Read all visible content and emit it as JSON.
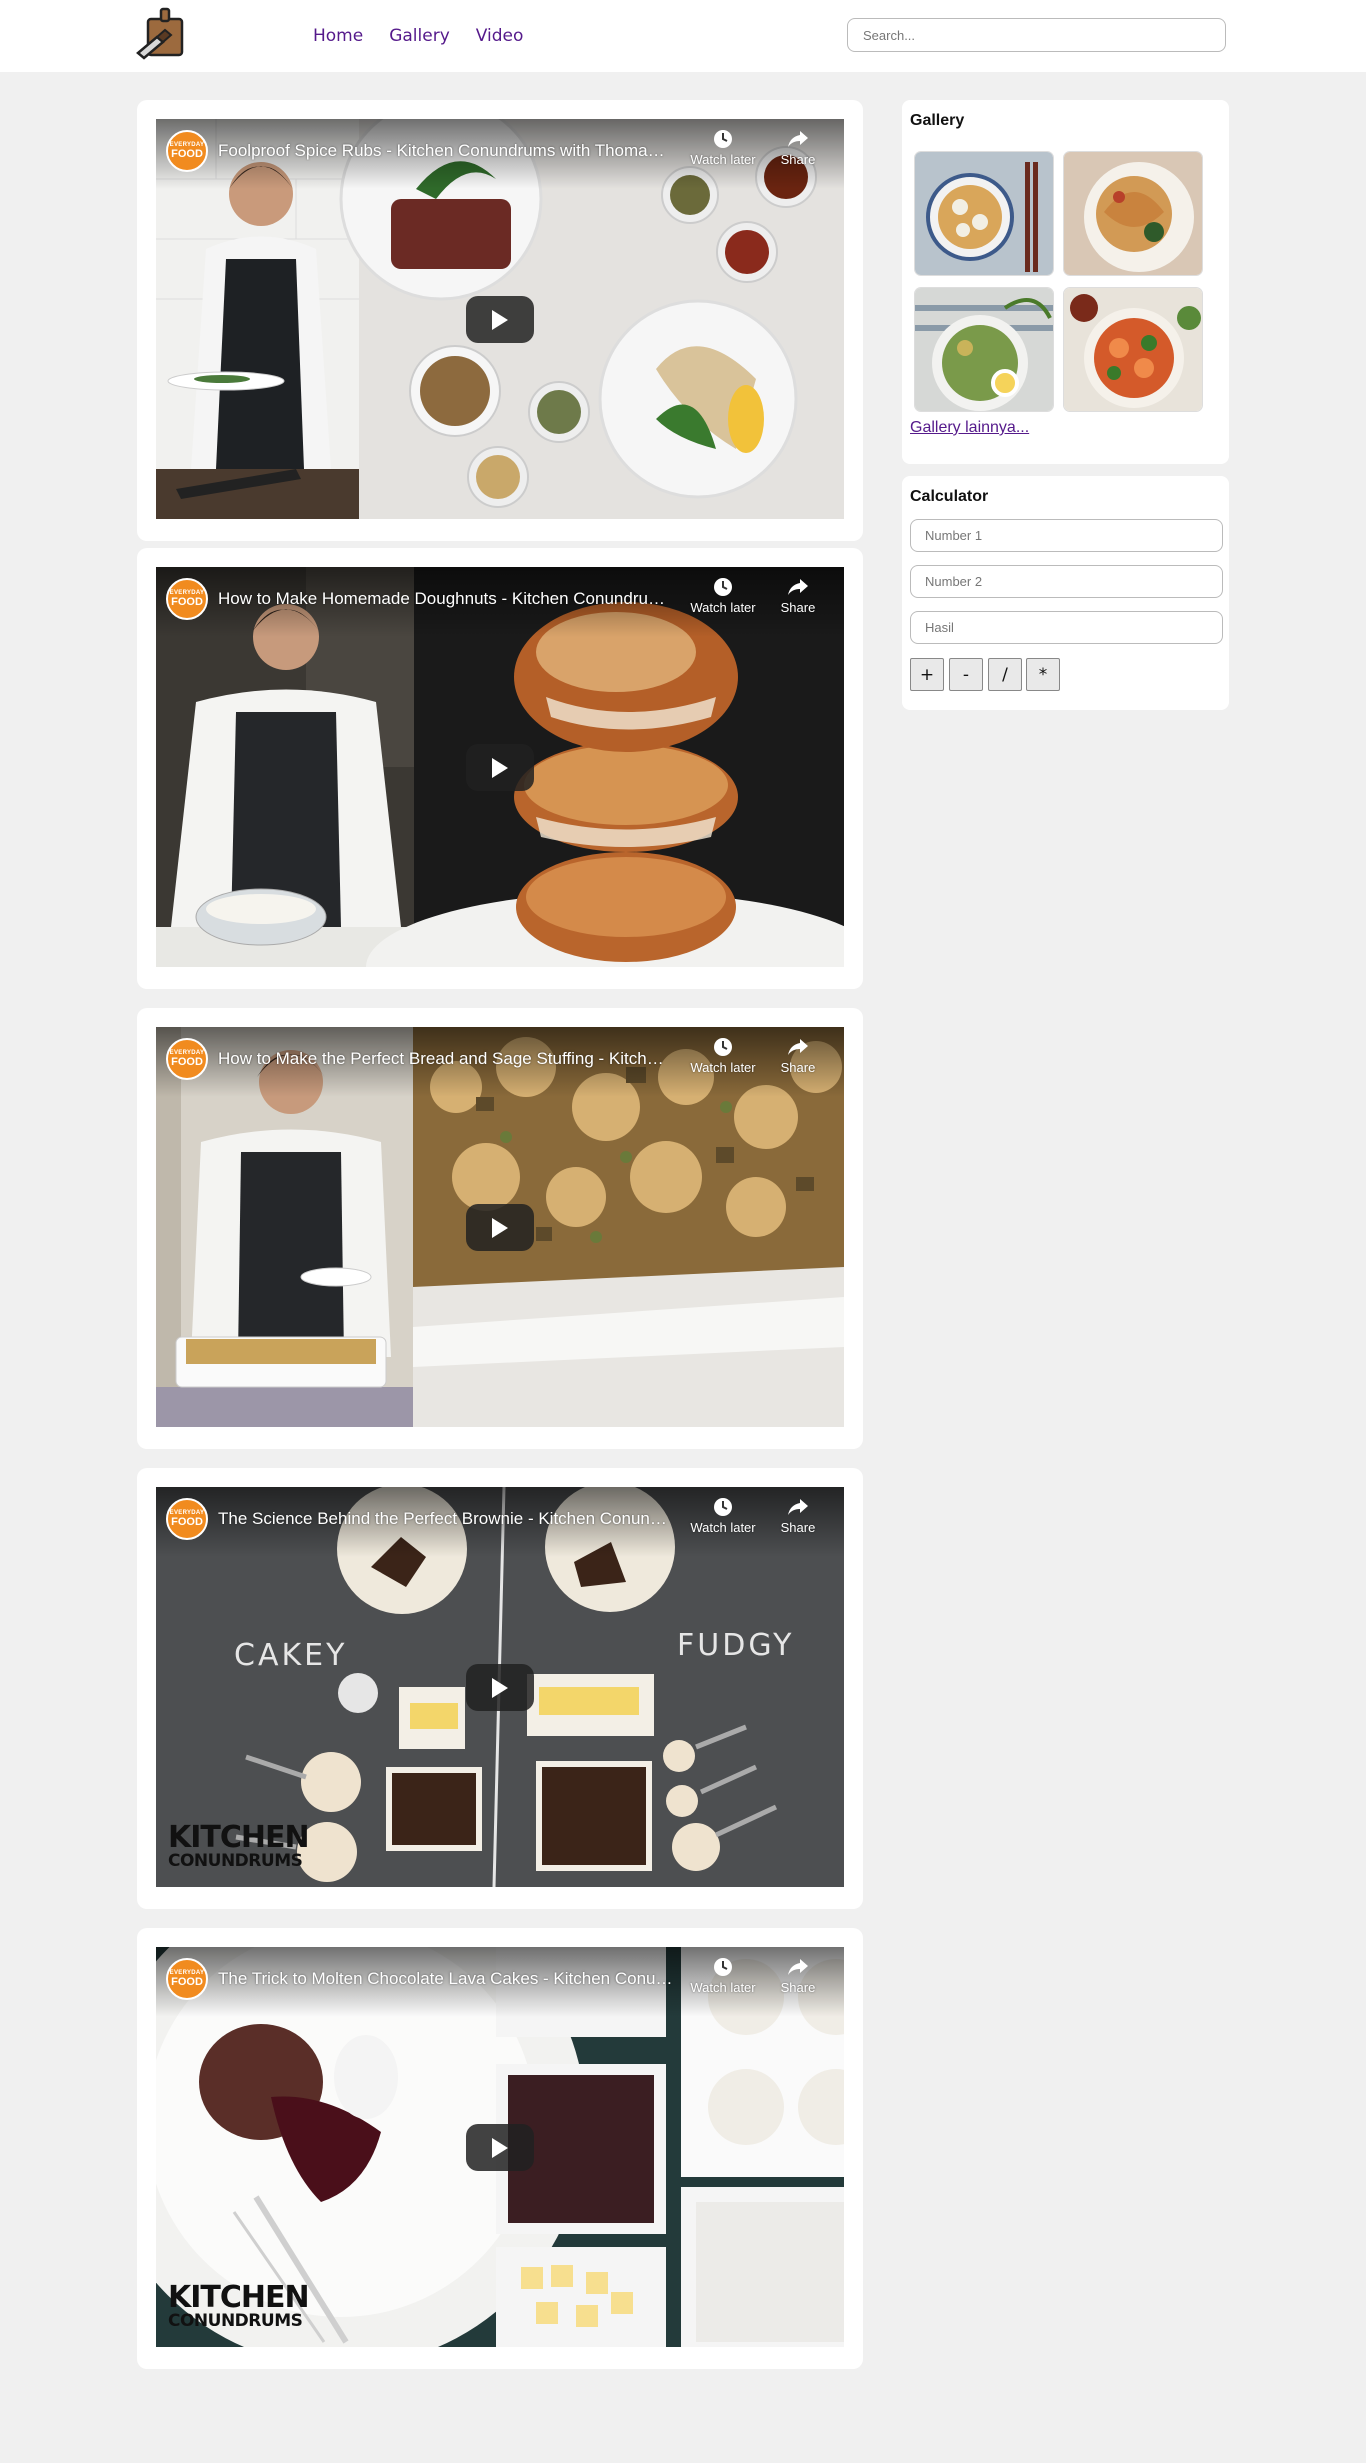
{
  "nav": {
    "items": [
      "Home",
      "Gallery",
      "Video"
    ]
  },
  "search": {
    "placeholder": "Search..."
  },
  "videos": [
    {
      "title": "Foolproof Spice Rubs - Kitchen Conundrums with Thomas Joseph",
      "channel_small": "EVERYDAY",
      "channel_big": "FOOD",
      "watch_later": "Watch later",
      "share": "Share"
    },
    {
      "title": "How to Make Homemade Doughnuts - Kitchen Conundrums with Thomas Joseph",
      "channel_small": "EVERYDAY",
      "channel_big": "FOOD",
      "watch_later": "Watch later",
      "share": "Share"
    },
    {
      "title": "How to Make the Perfect Bread and Sage Stuffing - Kitchen Conundrums",
      "channel_small": "EVERYDAY",
      "channel_big": "FOOD",
      "watch_later": "Watch later",
      "share": "Share"
    },
    {
      "title": "The Science Behind the Perfect Brownie - Kitchen Conundrums",
      "channel_small": "EVERYDAY",
      "channel_big": "FOOD",
      "watch_later": "Watch later",
      "share": "Share",
      "overlay_left": "CAKEY",
      "overlay_right": "FUDGY",
      "brand_1": "KITCHEN",
      "brand_2": "CONUNDRUMS"
    },
    {
      "title": "The Trick to Molten Chocolate Lava Cakes - Kitchen Conundrums",
      "channel_small": "EVERYDAY",
      "channel_big": "FOOD",
      "watch_later": "Watch later",
      "share": "Share",
      "brand_1": "KITCHEN",
      "brand_2": "CONUNDRUMS"
    }
  ],
  "gallery": {
    "heading": "Gallery",
    "more_link": "Gallery lainnya..."
  },
  "calculator": {
    "heading": "Calculator",
    "number1_placeholder": "Number 1",
    "number2_placeholder": "Number 2",
    "result_placeholder": "Hasil",
    "buttons": [
      "+",
      "-",
      "/",
      "*"
    ]
  }
}
